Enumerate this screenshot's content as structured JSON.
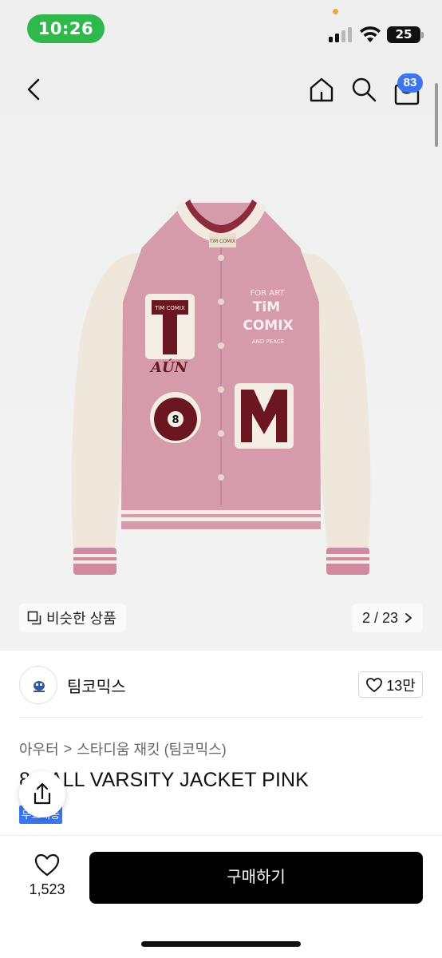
{
  "status_bar": {
    "time": "10:26",
    "battery": "25"
  },
  "nav": {
    "cart_count": "83"
  },
  "image": {
    "similar_label": "비슷한 상품",
    "pager": "2 / 23"
  },
  "brand": {
    "name": "팀코믹스",
    "likes": "13만"
  },
  "breadcrumb": {
    "category": "아우터",
    "separator": ">",
    "subcategory": "스타디움 재킷 (팀코믹스)"
  },
  "product": {
    "title": "8 BALL VARSITY JACKET PINK",
    "tag": "무료배송"
  },
  "bottom": {
    "wish_count": "1,523",
    "buy_label": "구매하기"
  },
  "jacket_patches": {
    "letter1": "T",
    "letter2": "M",
    "ball": "8",
    "script": "AÚN",
    "art_top": "FOR ART",
    "art_mid1": "TiM",
    "art_mid2": "COMIX",
    "art_bottom": "AND PEACE",
    "label_patch": "TiM COMIX"
  }
}
